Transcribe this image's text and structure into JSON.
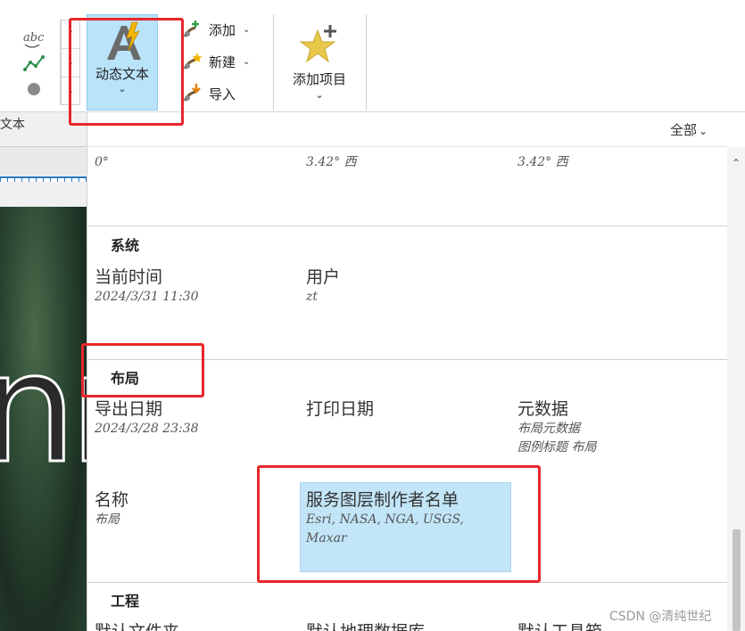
{
  "ribbon": {
    "group_label_fragment": "文本",
    "dynamic_text_label": "动态文本",
    "menu_items": [
      {
        "label": "添加",
        "has_dropdown": true
      },
      {
        "label": "新建",
        "has_dropdown": true
      },
      {
        "label": "导入",
        "has_dropdown": false
      }
    ],
    "add_item_label": "添加项目",
    "caret": "⌄"
  },
  "panel": {
    "filter": {
      "label": "全部",
      "caret": "⌄"
    },
    "top_row": [
      "0°",
      "3.42° 西",
      "3.42° 西"
    ],
    "sections": [
      {
        "title": "系统",
        "items": [
          {
            "title": "当前时间",
            "values": [
              "2024/3/31 11:30"
            ]
          },
          {
            "title": "用户",
            "values": [
              "zt"
            ]
          }
        ]
      },
      {
        "title": "布局",
        "items": [
          {
            "title": "导出日期",
            "values": [
              "2024/3/28 23:38"
            ]
          },
          {
            "title": "打印日期",
            "values": []
          },
          {
            "title": "元数据",
            "values": [
              "布局元数据",
              "图例标题 布局"
            ]
          },
          {
            "title": "名称",
            "values": [
              "布局"
            ]
          },
          {
            "title": "服务图层制作者名单",
            "values": [
              "Esri, NASA, NGA, USGS,",
              "Maxar"
            ],
            "selected": true
          }
        ]
      },
      {
        "title": "工程",
        "items": [
          {
            "title": "默认文件夹",
            "values": []
          },
          {
            "title": "默认地理数据库",
            "values": []
          },
          {
            "title": "默认工具箱",
            "values": []
          }
        ]
      }
    ]
  },
  "watermark": "CSDN @清纯世纪",
  "colors": {
    "selection_bg": "#c2e5f8",
    "button_active_bg": "#b9e3f9",
    "annotation_red": "#e8262a"
  }
}
